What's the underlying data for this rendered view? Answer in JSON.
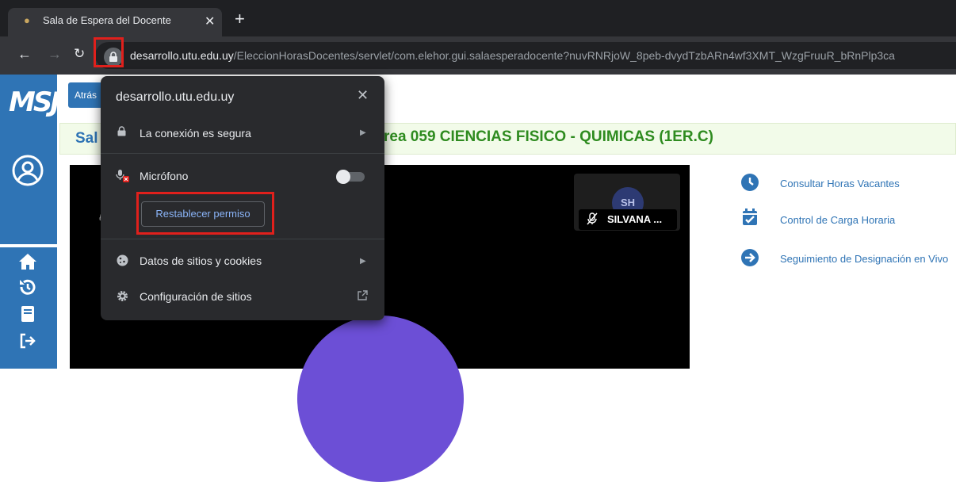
{
  "browser": {
    "tab_title": "Sala de Espera del Docente",
    "tab_close": "✕",
    "new_tab": "+",
    "url_host": "desarrollo.utu.edu.uy",
    "url_path": "/EleccionHorasDocentes/servlet/com.elehor.gui.salaesperadocente?nuvRNRjoW_8peb-dvydTzbARn4wf3XMT_WzgFruuR_bRnPlp3ca"
  },
  "page": {
    "logo_text": "MSJ",
    "back_button": "Atrás",
    "title_left": "Sal",
    "title_right": "rea 059 CIENCIAS FISICO - QUIMICAS (1ER.C)",
    "participant_initials": "SH",
    "participant_name": "SILVANA ...",
    "video_glyph": "ℓ",
    "links": [
      {
        "label": "Consultar Horas Vacantes",
        "icon": "clock-icon"
      },
      {
        "label": "Control de Carga Horaria",
        "icon": "calendar-check-icon"
      },
      {
        "label": "Seguimiento de Designación en Vivo",
        "icon": "arrow-circle-right-icon"
      }
    ],
    "brand_color": "#2f74b5"
  },
  "popup": {
    "site": "desarrollo.utu.edu.uy",
    "close": "✕",
    "connection": "La conexión es segura",
    "microphone": "Micrófono",
    "reset_permission": "Restablecer permiso",
    "cookies": "Datos de sitios y cookies",
    "site_settings": "Configuración de sitios"
  }
}
